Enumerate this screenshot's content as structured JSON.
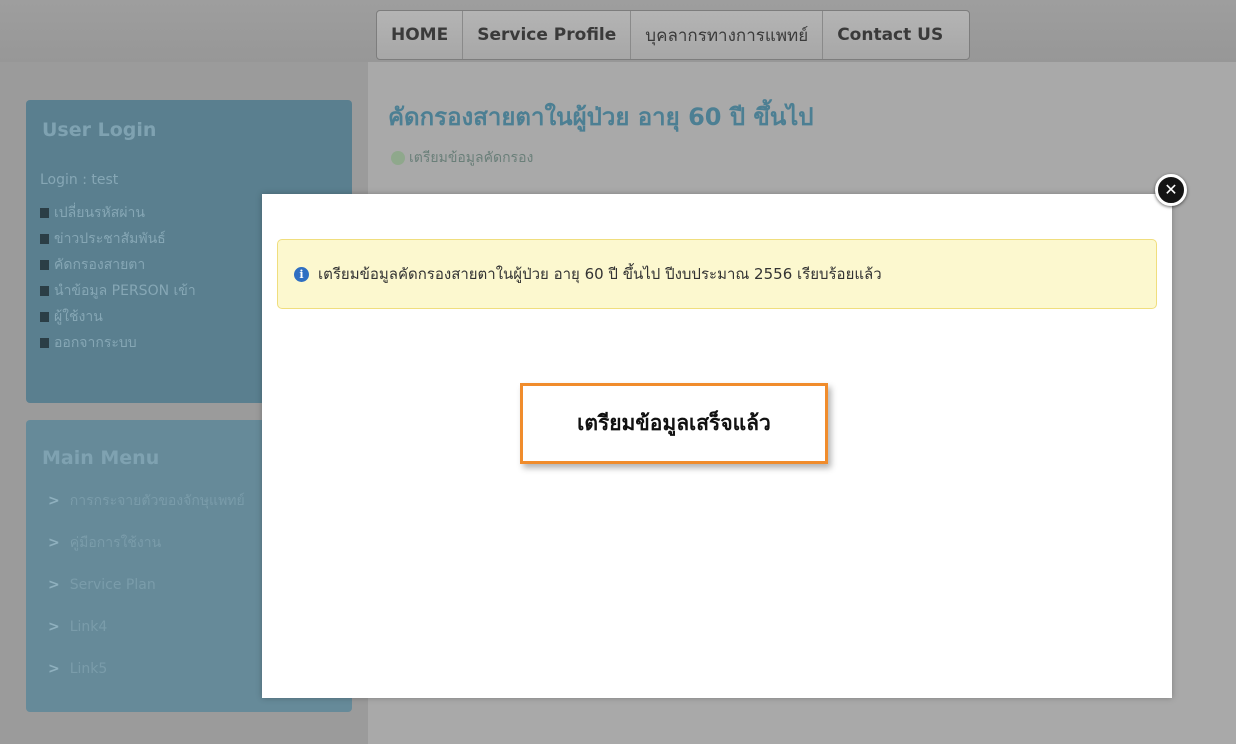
{
  "nav": {
    "items": [
      "HOME",
      "Service Profile",
      "บุคลากรทางการแพทย์",
      "Contact US"
    ]
  },
  "user_login": {
    "title": "User Login",
    "user_line": "Login : test",
    "links": [
      "เปลี่ยนรหัสผ่าน",
      "ข่าวประชาสัมพันธ์",
      "คัดกรองสายตา",
      "นำข้อมูล PERSON เข้า",
      "ผู้ใช้งาน",
      "ออกจากระบบ"
    ]
  },
  "main_menu": {
    "title": "Main Menu",
    "items": [
      "การกระจายตัวของจักษุแพทย์",
      "คู่มือการใช้งาน",
      "Service Plan",
      "Link4",
      "Link5"
    ]
  },
  "page": {
    "title": "คัดกรองสายตาในผู้ป่วย อายุ 60 ปี ขึ้นไป",
    "status": "เตรียมข้อมูลคัดกรอง"
  },
  "modal": {
    "close_symbol": "✕",
    "alert_icon": "i",
    "alert_text": "เตรียมข้อมูลคัดกรองสายตาในผู้ป่วย อายุ 60 ปี ขึ้นไป ปีงบประมาณ 2556 เรียบร้อยแล้ว",
    "callout_text": "เตรียมข้อมูลเสร็จแล้ว"
  },
  "colors": {
    "modal_bg": "#ffffff",
    "alert_bg": "#fcf8cf",
    "alert_border": "#f0de7e",
    "info_icon": "#2f6fc2",
    "callout_border": "#f08c2c",
    "overlay": "#a3a3a3"
  }
}
